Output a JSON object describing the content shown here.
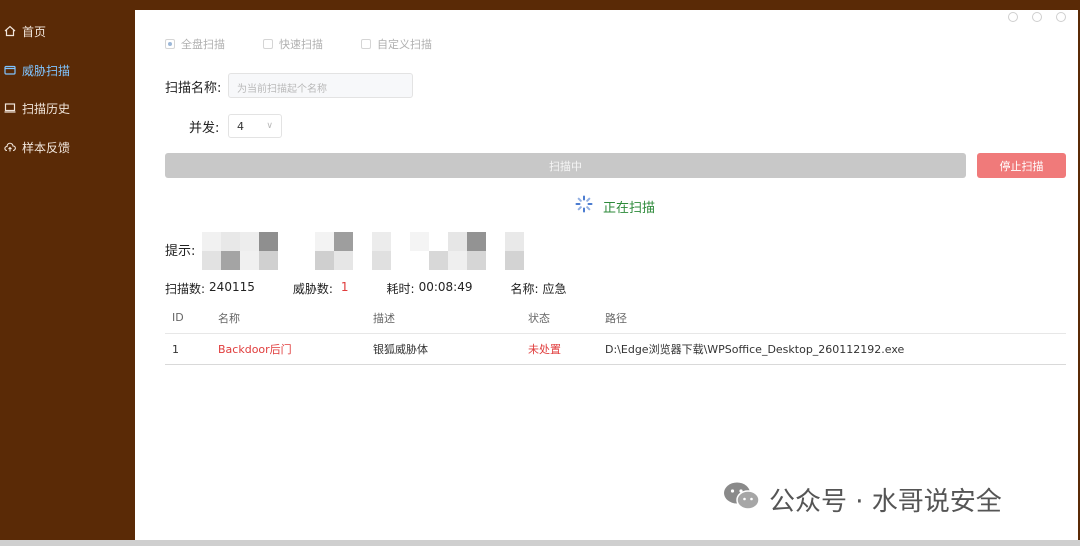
{
  "sidebar": {
    "items": [
      {
        "label": "首页",
        "icon": "home-icon"
      },
      {
        "label": "威胁扫描",
        "icon": "scan-icon",
        "active": true
      },
      {
        "label": "扫描历史",
        "icon": "history-icon"
      },
      {
        "label": "样本反馈",
        "icon": "cloud-upload-icon"
      }
    ]
  },
  "scan_modes": [
    {
      "label": "全盘扫描",
      "selected": true
    },
    {
      "label": "快速扫描",
      "selected": false
    },
    {
      "label": "自定义扫描",
      "selected": false
    }
  ],
  "form": {
    "name_label": "扫描名称:",
    "name_placeholder": "为当前扫描起个名称",
    "concurrency_label": "并发:",
    "concurrency_value": "4"
  },
  "actions": {
    "progress_label": "扫描中",
    "stop_label": "停止扫描"
  },
  "status": {
    "scanning_text": "正在扫描"
  },
  "hint": {
    "label": "提示:"
  },
  "stats": {
    "scanned_label": "扫描数:",
    "scanned_value": "240115",
    "threats_label": "威胁数:",
    "threats_value": "1",
    "elapsed_label": "耗时:",
    "elapsed_value": "00:08:49",
    "name_label": "名称:",
    "name_value": "应急"
  },
  "table": {
    "headers": [
      "ID",
      "名称",
      "描述",
      "状态",
      "路径"
    ],
    "rows": [
      {
        "id": "1",
        "name": "Backdoor后门",
        "desc": "银狐威胁体",
        "status": "未处置",
        "path": "D:\\Edge浏览器下载\\WPSoffice_Desktop_260112192.exe"
      }
    ]
  },
  "watermark": {
    "text": "公众号 · 水哥说安全"
  },
  "colors": {
    "sidebar_bg": "#5a2a06",
    "active_nav": "#7fc4ff",
    "danger": "#e03c3c",
    "scanning_green": "#2d8a3a",
    "stop_button": "#f07a7a"
  }
}
